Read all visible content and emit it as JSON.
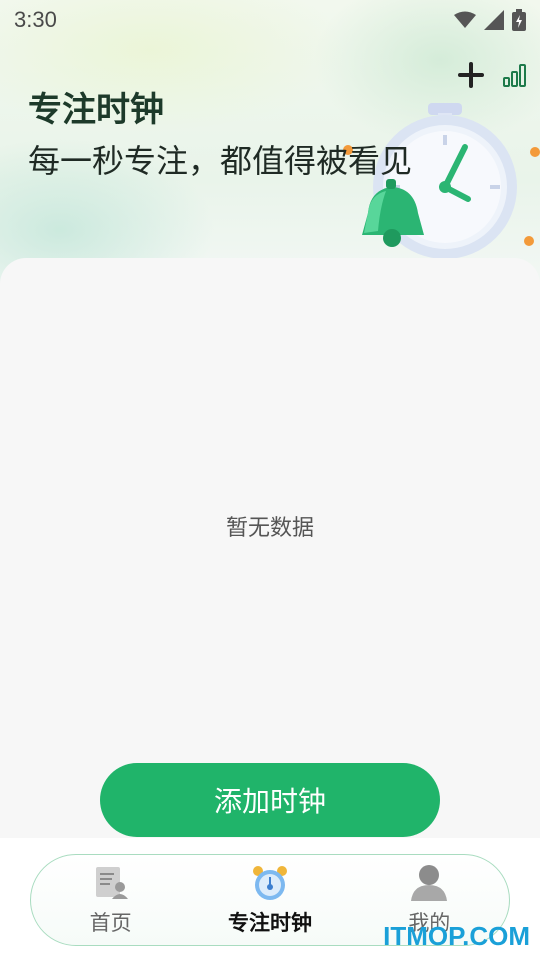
{
  "status_bar": {
    "time": "3:30",
    "icons": [
      "wifi-icon",
      "cell-signal-icon",
      "battery-charging-icon"
    ]
  },
  "header": {
    "title": "专注时钟",
    "subtitle": "每一秒专注，都值得被看见",
    "actions": [
      "plus-icon",
      "stats-icon"
    ]
  },
  "content": {
    "empty_text": "暂无数据"
  },
  "add_button": {
    "label": "添加时钟"
  },
  "tabs": [
    {
      "label": "首页",
      "icon": "document-user-icon",
      "active": false
    },
    {
      "label": "专注时钟",
      "icon": "alarm-clock-icon",
      "active": true
    },
    {
      "label": "我的",
      "icon": "person-icon",
      "active": false
    }
  ],
  "watermark": "ITMOP.COM",
  "colors": {
    "accent": "#20b46a",
    "title": "#1d3a2a",
    "tab_border": "#a9dcc0",
    "watermark": "#1aa0d8"
  }
}
